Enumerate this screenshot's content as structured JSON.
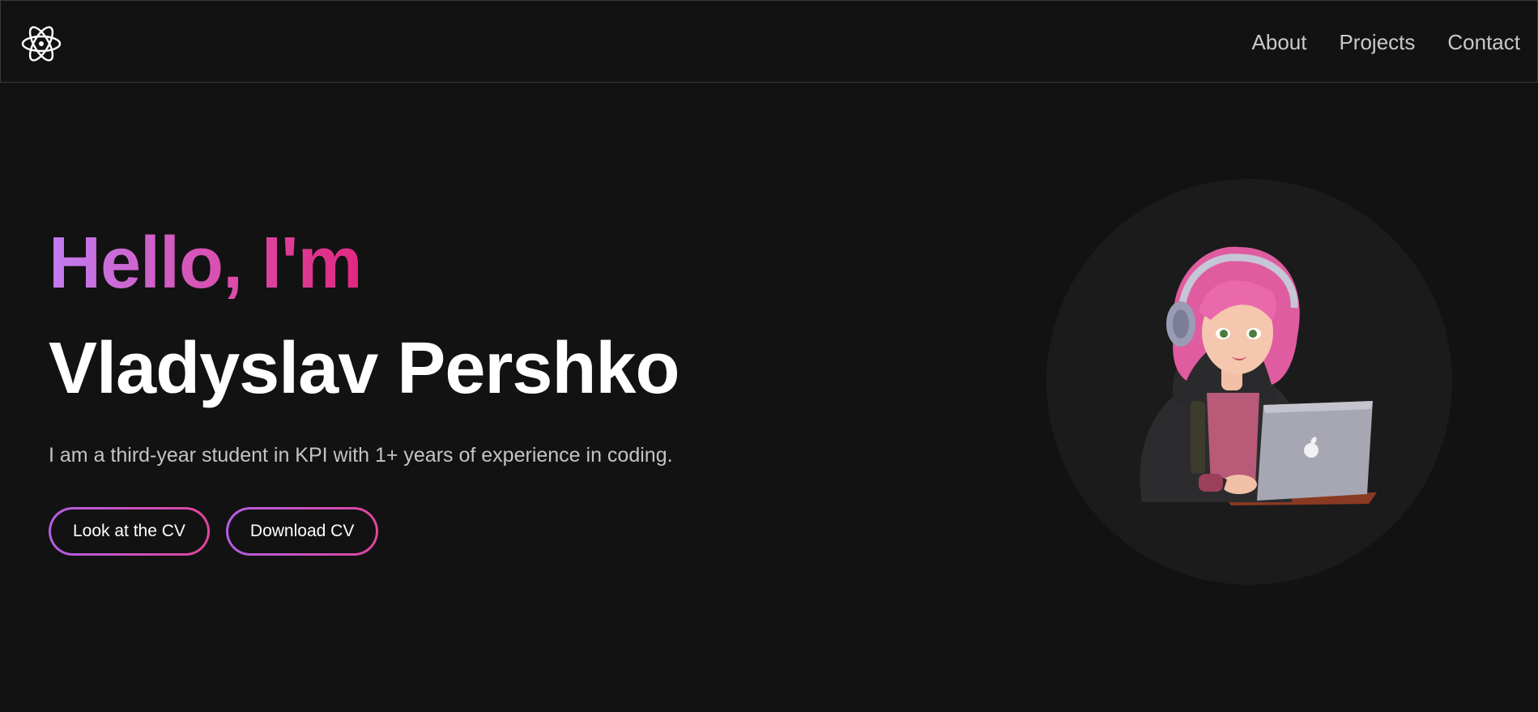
{
  "header": {
    "logo_icon": "atom-icon",
    "nav": [
      {
        "label": "About"
      },
      {
        "label": "Projects"
      },
      {
        "label": "Contact"
      }
    ]
  },
  "hero": {
    "greeting": "Hello, I'm",
    "name": "Vladyslav Pershko",
    "bio": "I am a third-year student in KPI with 1+ years of experience in coding.",
    "buttons": {
      "look_cv": "Look at the CV",
      "download_cv": "Download CV"
    },
    "avatar_icon": "avatar-illustration"
  },
  "colors": {
    "background": "#121212",
    "gradient_start": "#c17cf1",
    "gradient_end": "#e0287f",
    "avatar_circle": "#1b1b1b"
  }
}
